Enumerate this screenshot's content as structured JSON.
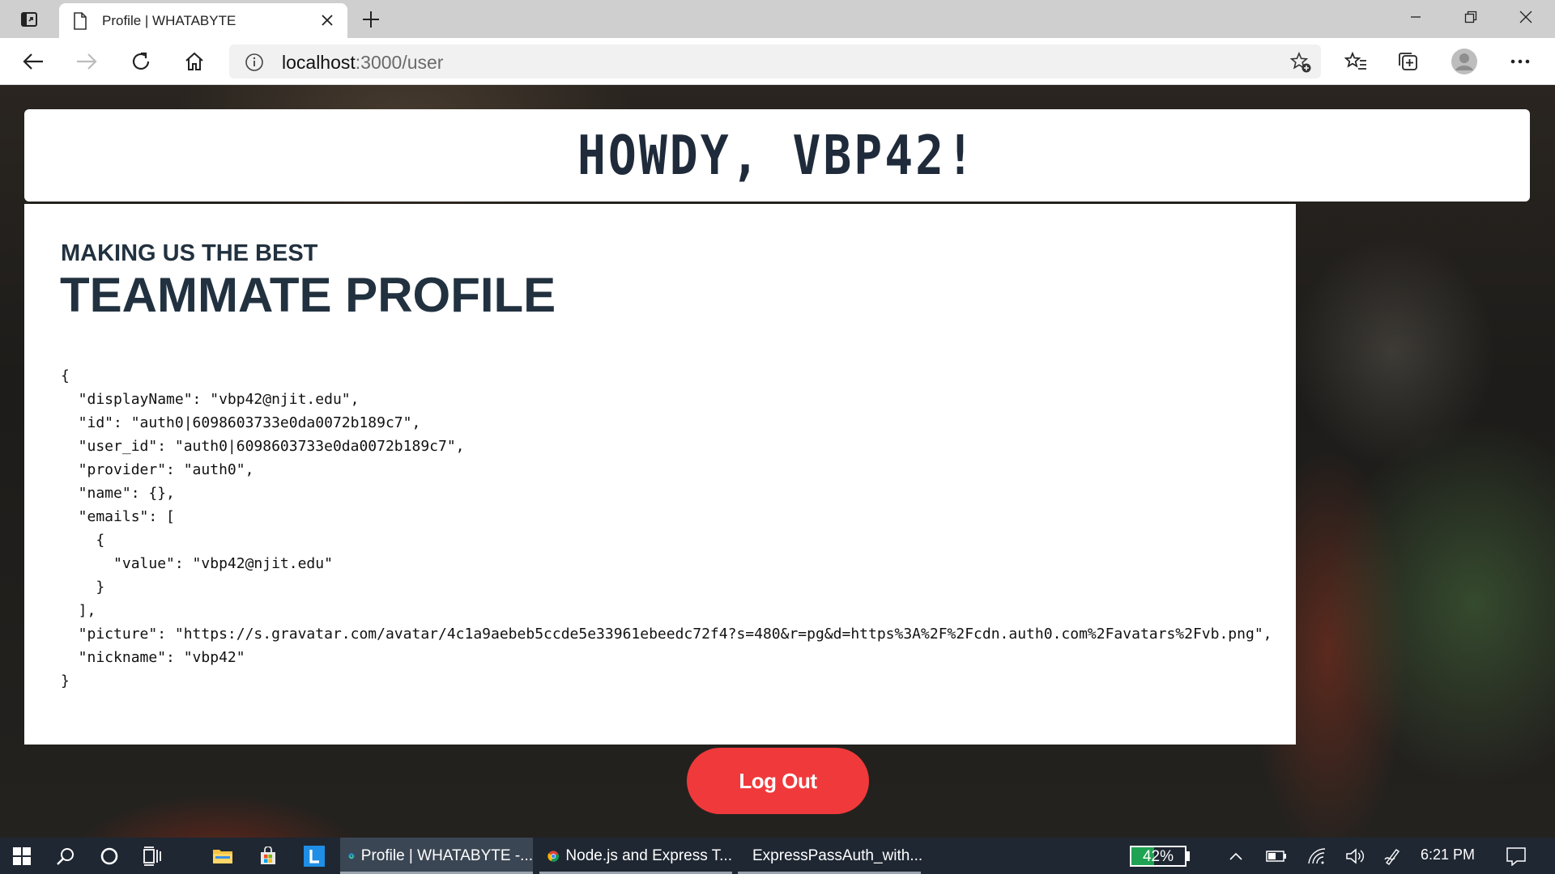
{
  "browser": {
    "tab": {
      "title": "Profile | WHATABYTE"
    },
    "address": {
      "host": "localhost",
      "path": ":3000/user"
    }
  },
  "page": {
    "greeting": "HOWDY, VBP42!",
    "profile": {
      "subheading": "MAKING US THE BEST",
      "heading": "TEAMMATE PROFILE",
      "json_text": "{\n  \"displayName\": \"vbp42@njit.edu\",\n  \"id\": \"auth0|6098603733e0da0072b189c7\",\n  \"user_id\": \"auth0|6098603733e0da0072b189c7\",\n  \"provider\": \"auth0\",\n  \"name\": {},\n  \"emails\": [\n    {\n      \"value\": \"vbp42@njit.edu\"\n    }\n  ],\n  \"picture\": \"https://s.gravatar.com/avatar/4c1a9aebeb5ccde5e33961ebeedc72f4?s=480&r=pg&d=https%3A%2F%2Fcdn.auth0.com%2Favatars%2Fvb.png\",\n  \"nickname\": \"vbp42\"\n}"
    },
    "logout_label": "Log Out",
    "accent_color": "#f0393b"
  },
  "taskbar": {
    "apps": [
      {
        "label": "Profile | WHATABYTE -...",
        "icon": "edge-icon",
        "active": true
      },
      {
        "label": "Node.js and Express T...",
        "icon": "chrome-icon",
        "active": false
      },
      {
        "label": "ExpressPassAuth_with...",
        "icon": "webstorm-icon",
        "active": false
      }
    ],
    "battery": {
      "label": "42%",
      "level": 0.42
    },
    "clock": "6:21 PM"
  }
}
